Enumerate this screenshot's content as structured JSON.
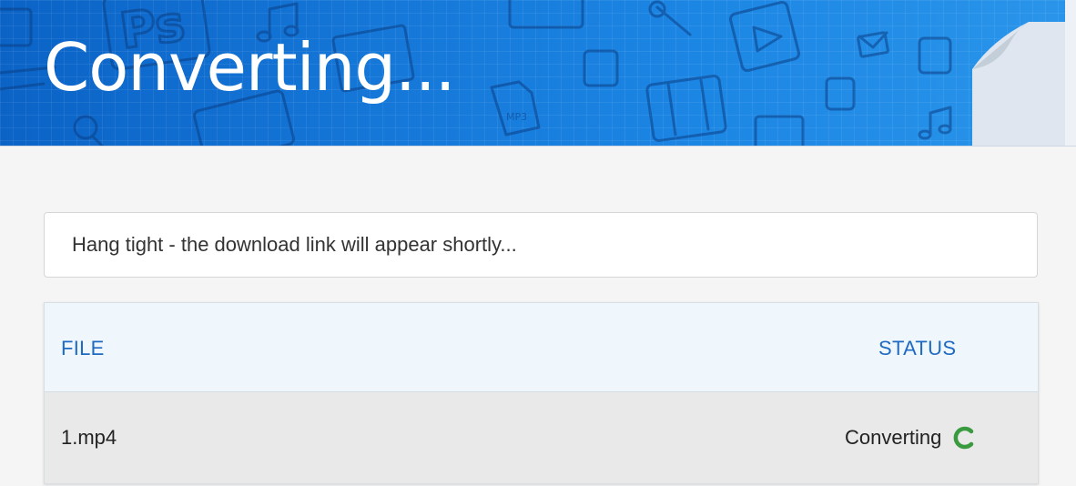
{
  "header": {
    "title": "Converting..."
  },
  "notice": {
    "text": "Hang tight - the download link will appear shortly..."
  },
  "table": {
    "columns": [
      "FILE",
      "STATUS"
    ],
    "rows": [
      {
        "file": "1.mp4",
        "status": "Converting"
      }
    ]
  },
  "colors": {
    "banner": "#1577d8",
    "header_text": "#1e6ac2",
    "spinner": "#3a9a3f"
  },
  "icons": [
    "photoshop-icon",
    "music-note-icon",
    "wrench-icon",
    "play-icon",
    "envelope-icon",
    "lock-icon",
    "mp3-file-icon",
    "film-icon",
    "magnifier-icon",
    "image-icon",
    "contact-icon",
    "page-curl-icon",
    "spinner-icon"
  ]
}
